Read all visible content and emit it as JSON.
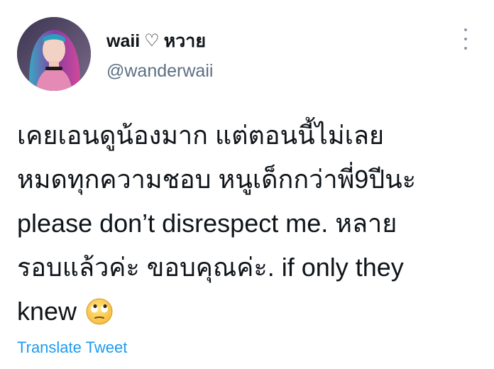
{
  "tweet": {
    "author": {
      "display_name": "waii",
      "heart_glyph": "♡",
      "thai_name": "หวาย",
      "handle": "@wanderwaii",
      "avatar_icon": "profile-photo"
    },
    "more_icon": "vertical-dots-icon",
    "body_lines": [
      "เคยเอนดูน้องมาก แต่ตอนนี้ไม่เลย",
      "หมดทุกความชอบ หนูเด็กกว่าพี่9ปีนะ",
      "please don’t disrespect me. หลาย",
      "รอบแล้วค่ะ ขอบคุณค่ะ. if only they",
      "knew"
    ],
    "emoji": "face-with-rolling-eyes",
    "translate_label": "Translate Tweet"
  },
  "colors": {
    "text": "#0f1419",
    "secondary": "#5b7083",
    "link": "#1d9bf0"
  }
}
